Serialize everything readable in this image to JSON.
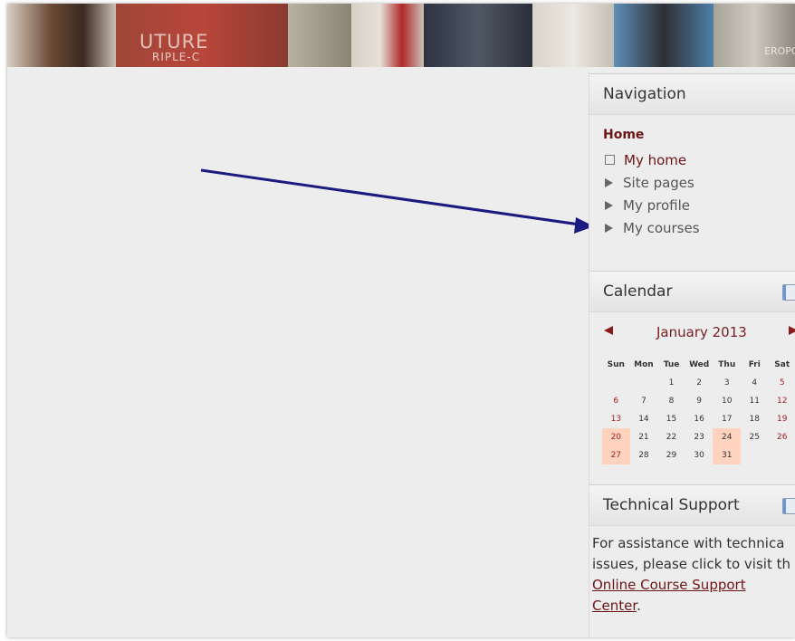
{
  "banner": {
    "text_line1": "UTURE",
    "text_line2": "RIPLE-C",
    "text_right": "EROPOS"
  },
  "navigation": {
    "title": "Navigation",
    "home_label": "Home",
    "items": [
      {
        "label": "My home",
        "icon": "square-bullet-icon"
      },
      {
        "label": "Site pages",
        "icon": "expand-arrow-icon"
      },
      {
        "label": "My profile",
        "icon": "expand-arrow-icon"
      },
      {
        "label": "My courses",
        "icon": "expand-arrow-icon"
      }
    ]
  },
  "calendar": {
    "title": "Calendar",
    "month_label": "January 2013",
    "weekdays": [
      "Sun",
      "Mon",
      "Tue",
      "Wed",
      "Thu",
      "Fri",
      "Sat"
    ],
    "weeks": [
      [
        "",
        "",
        "1",
        "2",
        "3",
        "4",
        "5"
      ],
      [
        "6",
        "7",
        "8",
        "9",
        "10",
        "11",
        "12"
      ],
      [
        "13",
        "14",
        "15",
        "16",
        "17",
        "18",
        "19"
      ],
      [
        "20",
        "21",
        "22",
        "23",
        "24",
        "25",
        "26"
      ],
      [
        "27",
        "28",
        "29",
        "30",
        "31",
        "",
        ""
      ]
    ],
    "highlighted_days": [
      "20",
      "24",
      "27",
      "31"
    ],
    "weekend_color": "#a32020",
    "highlight_color": "#ffd3bd"
  },
  "tech_support": {
    "title": "Technical Support",
    "text_line1": "For assistance with technica",
    "text_line2": "issues, please click to visit th",
    "link_line1": "Online Course Support",
    "link_line2": "Center",
    "suffix": "."
  },
  "colors": {
    "accent": "#6e1414",
    "arrow": "#1a1a80"
  }
}
